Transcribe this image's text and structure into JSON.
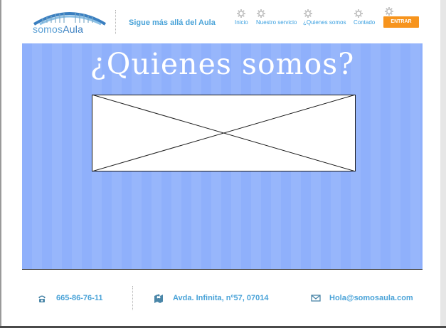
{
  "brand": {
    "name_part1": "somos",
    "name_part2": "Aula",
    "color": "#4aa3d8"
  },
  "header": {
    "tagline": "Sigue más allá del Aula"
  },
  "nav": {
    "items": [
      {
        "label": "Inicio",
        "icon": "gear-icon"
      },
      {
        "label": "Nuestro servicio",
        "icon": "gear-icon"
      },
      {
        "label": "¿Quienes somos",
        "icon": "gear-icon"
      },
      {
        "label": "Contado",
        "icon": "gear-icon"
      }
    ],
    "enter_label": "ENTRAR",
    "enter_color": "#f7941d"
  },
  "hero": {
    "title": "¿Quienes somos?",
    "background": "#8fb0fb",
    "image_placeholder": "image-placeholder"
  },
  "footer": {
    "phone": "665-86-76-11",
    "address": "Avda. Infinita, nº57, 07014",
    "email": "Hola@somosaula.com"
  }
}
